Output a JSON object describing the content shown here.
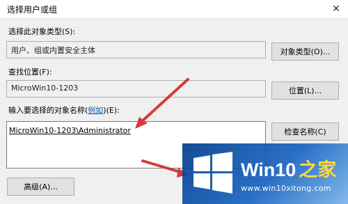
{
  "window": {
    "title": "选择用户或组"
  },
  "object_type": {
    "label": "选择此对象类型(S):",
    "value": "用户、组或内置安全主体",
    "button": "对象类型(O)..."
  },
  "location": {
    "label": "查找位置(F):",
    "value": "MicroWin10-1203",
    "button": "位置(L)..."
  },
  "names": {
    "label_prefix": "输入要选择的对象名称(",
    "label_link": "例如",
    "label_suffix": ")(E):",
    "value": "MicroWin10-1203\\Administrator",
    "check_button": "检查名称(C)"
  },
  "advanced_button": "高级(A)...",
  "annotation": {
    "arrow_color": "#d63a3a"
  },
  "watermark": {
    "brand_main": "Win10",
    "brand_suffix": "之家",
    "url": "www.win10xitong.com"
  }
}
